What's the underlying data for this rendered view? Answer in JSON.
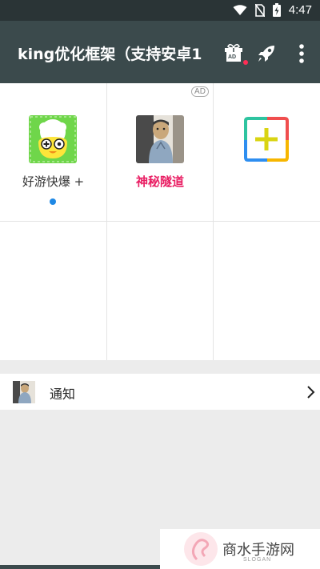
{
  "status_bar": {
    "time": "4:47"
  },
  "app_bar": {
    "title": "king优化框架（支持安卓1",
    "gift_badge": "AD"
  },
  "apps": [
    {
      "name": "好游快爆 +",
      "icon": "chick-app-icon",
      "has_dot": true
    },
    {
      "name": "神秘隧道",
      "icon": "person-app-icon",
      "ad": "AD"
    },
    {
      "name": "",
      "icon": "add-plus-icon"
    }
  ],
  "notice": {
    "label": "通知"
  },
  "watermark": {
    "text": "商水手游网",
    "slogan": "SLOGAN"
  },
  "colors": {
    "app_bar": "#3b4a4c",
    "status_bar": "#2a3436",
    "accent_red": "#e91e63",
    "dot_blue": "#1e88e5"
  }
}
